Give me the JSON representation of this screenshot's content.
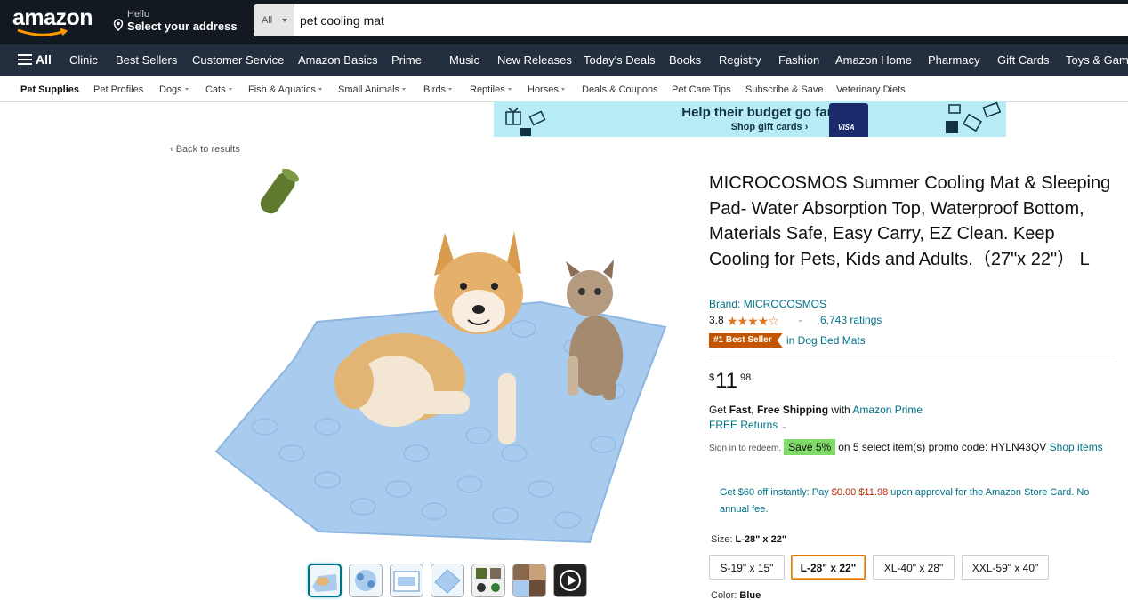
{
  "header": {
    "logo": "amazon",
    "location_hello": "Hello",
    "location_address": "Select your address",
    "search_category": "All",
    "search_value": "pet cooling mat"
  },
  "nav": {
    "all_label": "All",
    "items": [
      "Clinic",
      "Best Sellers",
      "Customer Service",
      "Amazon Basics",
      "Prime",
      "Music",
      "New Releases",
      "Today's Deals",
      "Books",
      "Registry",
      "Fashion",
      "Amazon Home",
      "Pharmacy",
      "Gift Cards",
      "Toys & Games"
    ]
  },
  "subnav": {
    "items": [
      "Pet Supplies",
      "Pet Profiles",
      "Dogs",
      "Cats",
      "Fish & Aquatics",
      "Small Animals",
      "Birds",
      "Reptiles",
      "Horses",
      "Deals & Coupons",
      "Pet Care Tips",
      "Subscribe & Save",
      "Veterinary Diets"
    ]
  },
  "banner": {
    "headline": "Help their budget go farther",
    "cta": "Shop gift cards ›",
    "card_text": "VISA"
  },
  "back_link": "‹ Back to results",
  "product": {
    "title": "MICROCOSMOS Summer Cooling Mat & Sleeping Pad- Water Absorption Top, Waterproof Bottom, Materials Safe, Easy Carry, EZ Clean. Keep Cooling for Pets, Kids and Adults.（27\"x 22\"） L",
    "brand": "Brand: MICROCOSMOS",
    "rating": "3.8",
    "rating_value": 3.8,
    "stars_text": "★★★★☆",
    "ratings_count": "6,743 ratings",
    "best_seller_badge": "#1 Best Seller",
    "best_seller_category": "in Dog Bed Mats",
    "price_symbol": "$",
    "price_whole": "11",
    "price_fraction": "98",
    "shipping_prefix": "Get ",
    "shipping_bold": "Fast, Free Shipping",
    "shipping_mid": " with ",
    "shipping_link": "Amazon Prime",
    "returns": "FREE Returns",
    "promo_signin": "Sign in to redeem.",
    "promo_save": "Save 5%",
    "promo_text": "on 5 select item(s) promo code: HYLN43QV",
    "promo_link": "Shop items",
    "store_offer_prefix": "Get $60 off instantly: Pay ",
    "store_offer_price": "$0.00",
    "store_offer_strike": "$11.98",
    "store_offer_suffix": " upon approval for the Amazon Store Card. No annual fee.",
    "size_label": "Size: ",
    "size_selected": "L-28\" x 22\"",
    "sizes": [
      "S-19\" x 15\"",
      "L-28\" x 22\"",
      "XL-40\" x 28\"",
      "XXL-59\" x 40\""
    ],
    "color_label": "Color: ",
    "color_selected": "Blue"
  },
  "colors": {
    "header_bg": "#131921",
    "nav_bg": "#232f3e",
    "link": "#007185",
    "mat_blue": "#a9ccee",
    "badge": "#c45500",
    "save_green": "#7fda69",
    "banner_bg": "#b7ecf5"
  }
}
